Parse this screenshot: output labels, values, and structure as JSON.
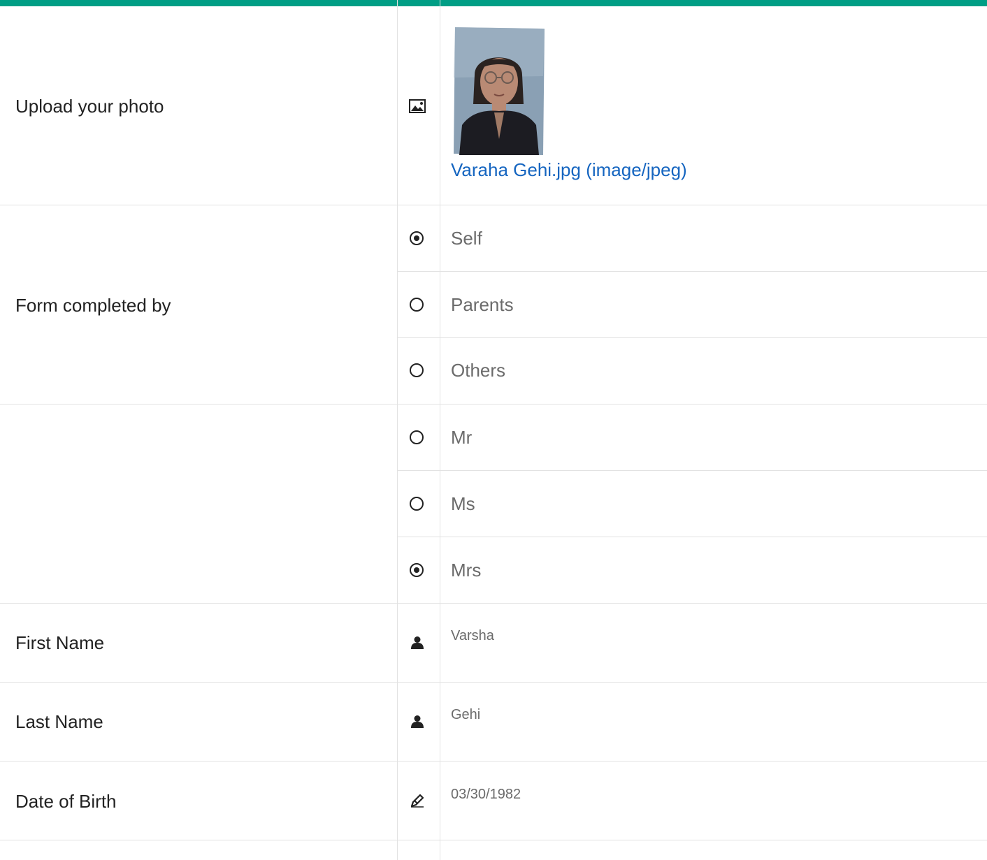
{
  "colors": {
    "accent": "#009e85",
    "link": "#1565c0",
    "muted_text": "#6b6b6b"
  },
  "photo_row": {
    "label": "Upload your photo",
    "icon": "image-icon",
    "file_link": "Varaha Gehi.jpg (image/jpeg)"
  },
  "form_completed_by": {
    "label": "Form completed by",
    "options": [
      {
        "label": "Self",
        "selected": true
      },
      {
        "label": "Parents",
        "selected": false
      },
      {
        "label": "Others",
        "selected": false
      }
    ]
  },
  "salutation": {
    "label": "",
    "options": [
      {
        "label": "Mr",
        "selected": false
      },
      {
        "label": "Ms",
        "selected": false
      },
      {
        "label": "Mrs",
        "selected": true
      }
    ]
  },
  "first_name": {
    "label": "First Name",
    "value": "Varsha",
    "icon": "person-icon"
  },
  "last_name": {
    "label": "Last Name",
    "value": "Gehi",
    "icon": "person-icon"
  },
  "dob": {
    "label": "Date of Birth",
    "value": "03/30/1982",
    "icon": "pencil-icon"
  }
}
